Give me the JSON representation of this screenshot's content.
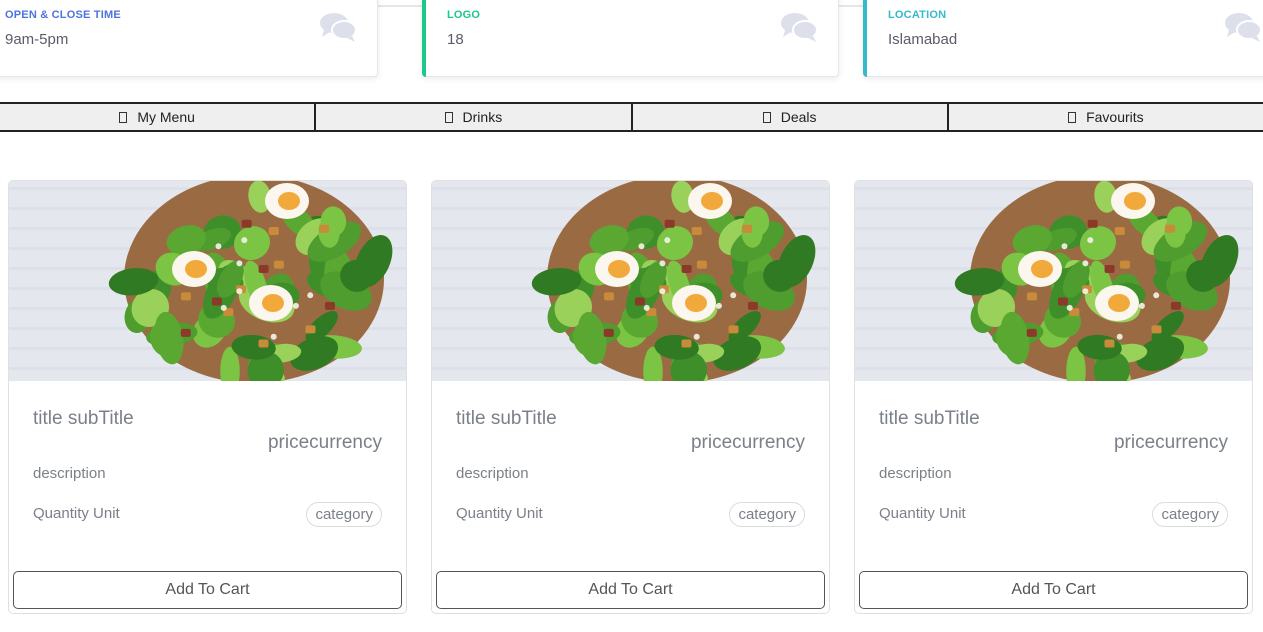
{
  "info_cards": {
    "hours": {
      "label": "OPEN & CLOSE TIME",
      "value": "9am-5pm",
      "accent": "#4e73df"
    },
    "logo": {
      "label": "LOGO",
      "value": "18",
      "accent": "#1cc88a"
    },
    "location": {
      "label": "LOCATION",
      "value": "Islamabad",
      "accent": "#36b9cc"
    },
    "icon": "comments-icon",
    "icon_color": "#dddfeb"
  },
  "tabs": [
    {
      "label": "My Menu"
    },
    {
      "label": "Drinks"
    },
    {
      "label": "Deals"
    },
    {
      "label": "Favourits"
    }
  ],
  "products": [
    {
      "title": "title subTitle",
      "price": "pricecurrency",
      "description": "description",
      "quantity": "Quantity Unit",
      "category": "category",
      "button": "Add To Cart"
    },
    {
      "title": "title subTitle",
      "price": "pricecurrency",
      "description": "description",
      "quantity": "Quantity Unit",
      "category": "category",
      "button": "Add To Cart"
    },
    {
      "title": "title subTitle",
      "price": "pricecurrency",
      "description": "description",
      "quantity": "Quantity Unit",
      "category": "category",
      "button": "Add To Cart"
    }
  ]
}
